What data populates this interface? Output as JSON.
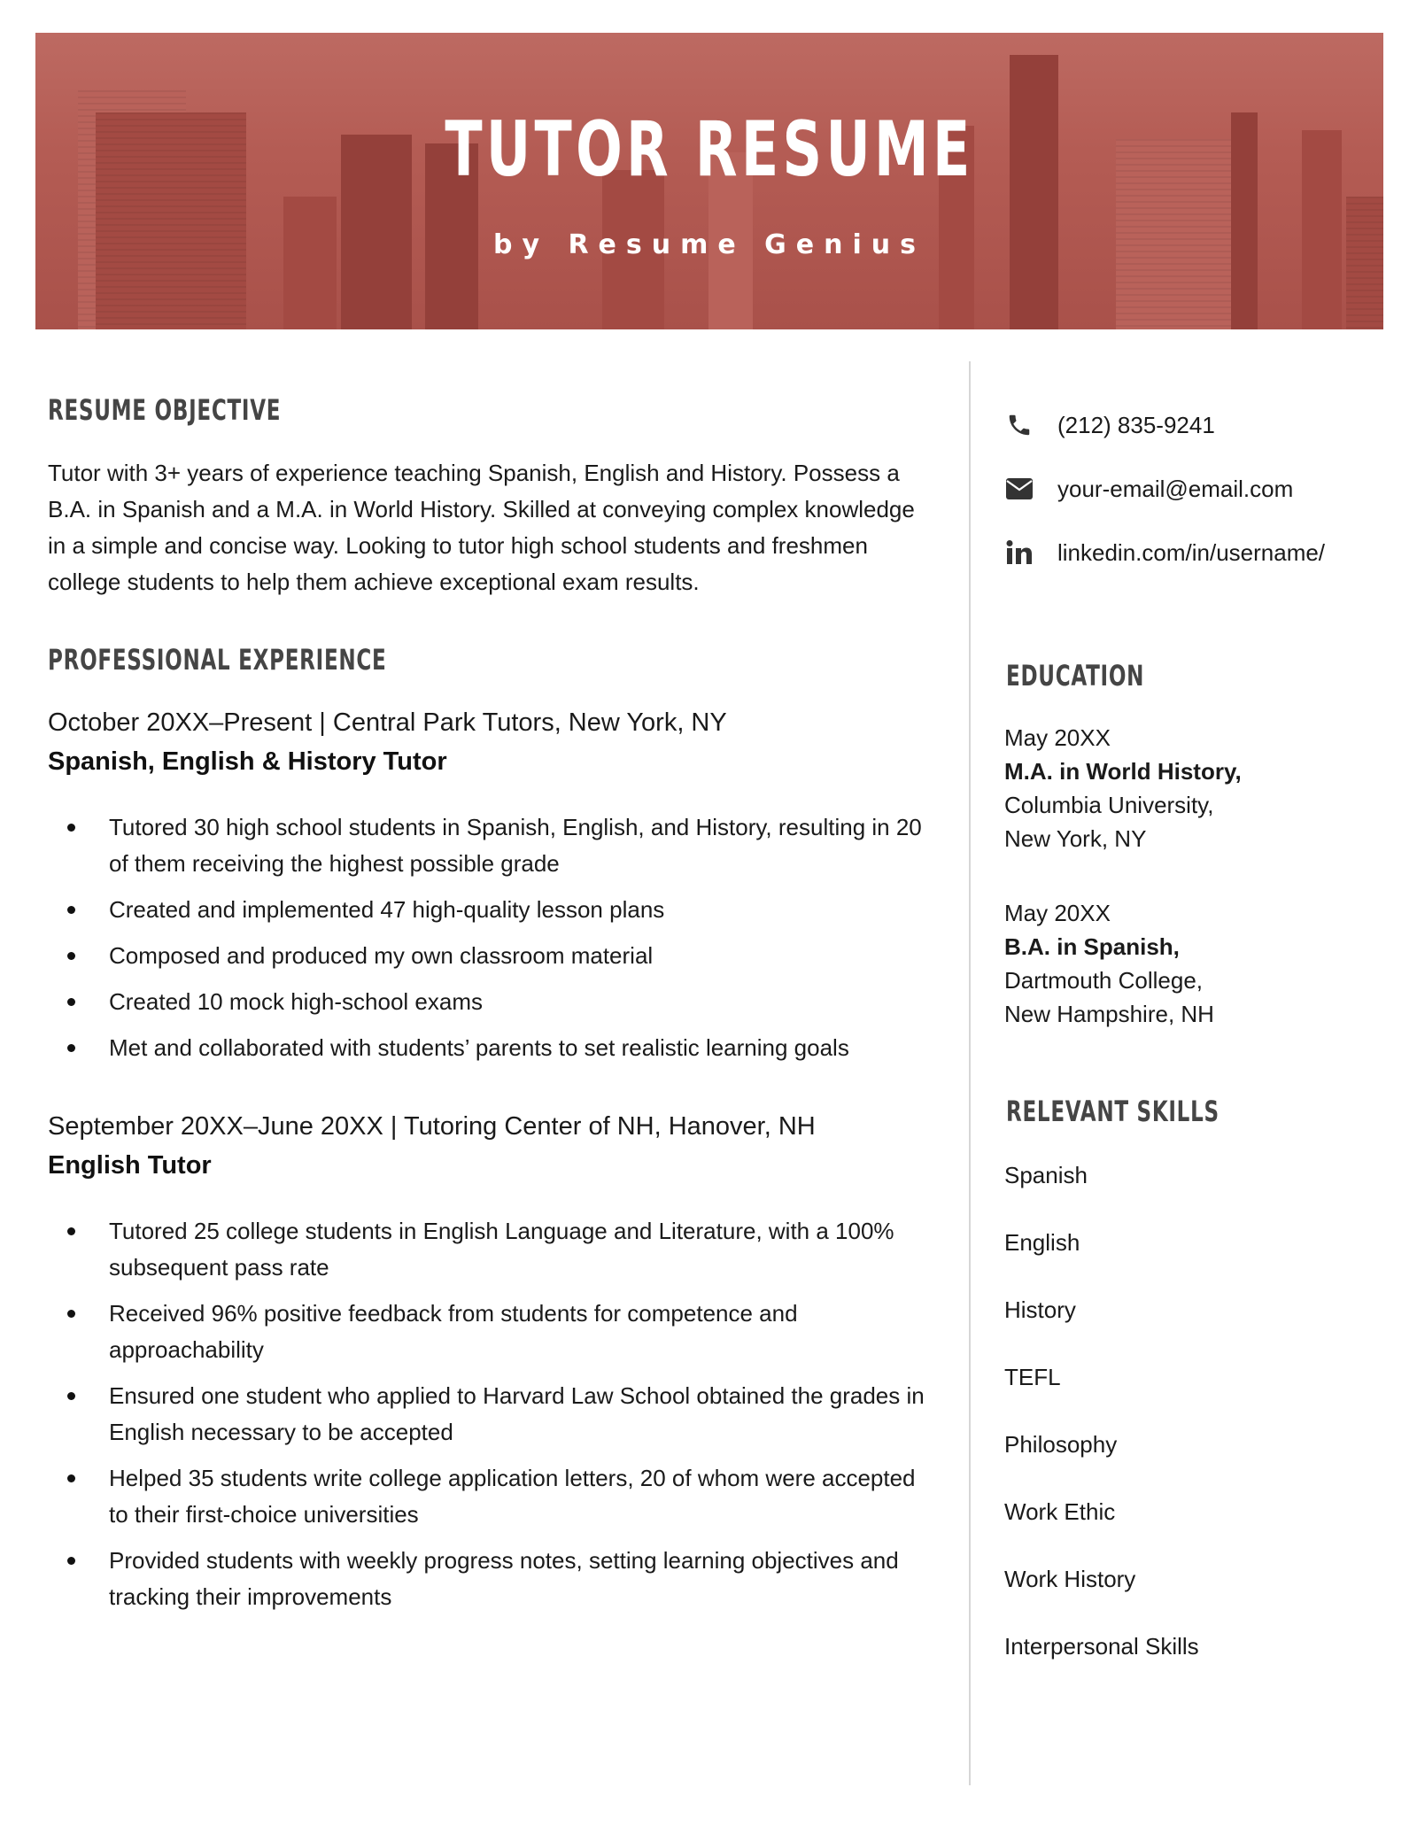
{
  "header": {
    "title": "TUTOR RESUME",
    "subtitle": "by Resume Genius",
    "banner_color": "#b5574f"
  },
  "objective": {
    "heading": "RESUME OBJECTIVE",
    "text": "Tutor with 3+ years of experience teaching Spanish, English and History. Possess a B.A. in Spanish and a M.A. in World History. Skilled at conveying complex knowledge in a simple and concise way. Looking to tutor high school students and freshmen college students to help them achieve exceptional exam results."
  },
  "experience": {
    "heading": "PROFESSIONAL EXPERIENCE",
    "jobs": [
      {
        "meta": "October 20XX–Present | Central Park Tutors, New York, NY",
        "title": "Spanish, English & History Tutor",
        "bullets": [
          "Tutored 30 high school students in Spanish, English, and History, resulting in 20 of them receiving the highest possible grade",
          "Created and implemented 47 high-quality lesson plans",
          "Composed and produced my own classroom material",
          "Created 10 mock high-school exams",
          "Met and collaborated with students’ parents to set realistic learning goals"
        ]
      },
      {
        "meta": "September 20XX–June 20XX | Tutoring Center of NH, Hanover, NH",
        "title": "English Tutor",
        "bullets": [
          "Tutored 25 college students in English Language and Literature, with a 100% subsequent pass rate",
          "Received 96% positive feedback from students for competence and approachability",
          "Ensured one student who applied to Harvard Law School obtained the grades in English necessary to be accepted",
          "Helped 35 students write college application letters, 20 of whom were accepted to their first-choice universities",
          "Provided students with weekly progress notes, setting learning objectives and tracking their improvements"
        ]
      }
    ]
  },
  "contact": {
    "items": [
      {
        "icon": "phone-icon",
        "text": "(212) 835-9241"
      },
      {
        "icon": "envelope-icon",
        "text": "your-email@email.com"
      },
      {
        "icon": "linkedin-icon",
        "text": "linkedin.com/in/username/"
      }
    ]
  },
  "education": {
    "heading": "EDUCATION",
    "entries": [
      {
        "date": "May 20XX",
        "degree": "M.A. in World History,",
        "school": "Columbia University,",
        "location": "New York, NY"
      },
      {
        "date": "May 20XX",
        "degree": "B.A. in Spanish,",
        "school": "Dartmouth College,",
        "location": "New Hampshire, NH"
      }
    ]
  },
  "skills": {
    "heading": "RELEVANT SKILLS",
    "items": [
      "Spanish",
      "English",
      "History",
      "TEFL",
      "Philosophy",
      "Work Ethic",
      "Work History",
      "Interpersonal Skills"
    ]
  }
}
